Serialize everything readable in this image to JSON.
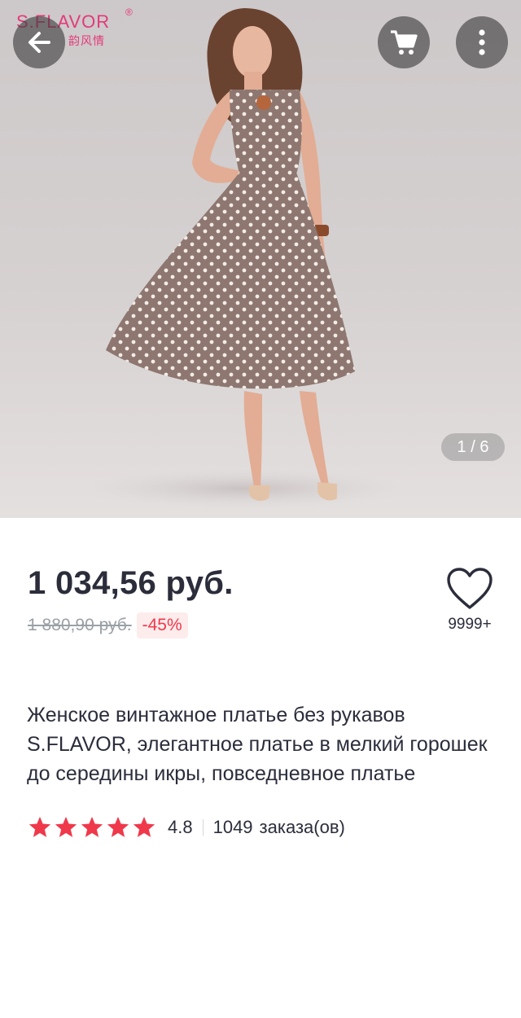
{
  "gallery": {
    "brand_name": "S.FLAVOR",
    "brand_registered": "®",
    "brand_sub": "韵风情",
    "counter": "1 / 6",
    "back_icon": "arrow-left-icon",
    "cart_icon": "cart-icon",
    "more_icon": "more-vertical-icon"
  },
  "product": {
    "price": "1 034,56 руб.",
    "old_price": "1 880,90 руб.",
    "discount": "-45%",
    "favorites_count": "9999+",
    "title": "Женское винтажное платье без рукавов S.FLAVOR, элегантное платье в мелкий горошек до середины икры, повседневное платье",
    "rating_value": "4.8",
    "orders_count": "1049",
    "orders_label": "заказа(ов)",
    "stars": 5
  },
  "colors": {
    "accent_red": "#f0384b",
    "star": "#f0384b",
    "brand_pink": "#e23a7a"
  }
}
